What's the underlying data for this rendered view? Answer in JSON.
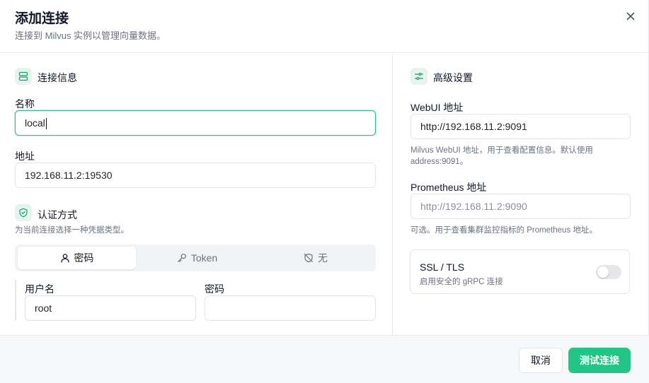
{
  "dialog": {
    "title": "添加连接",
    "subtitle": "连接到 Milvus 实例以管理向量数据。"
  },
  "connection_info": {
    "section_title": "连接信息",
    "name_label": "名称",
    "name_value": "local",
    "address_label": "地址",
    "address_value": "192.168.11.2:19530"
  },
  "auth": {
    "section_title": "认证方式",
    "description": "为当前连接选择一种凭据类型。",
    "tabs": [
      {
        "label": "密码",
        "icon": "user-icon",
        "active": true
      },
      {
        "label": "Token",
        "icon": "key-icon",
        "active": false
      },
      {
        "label": "无",
        "icon": "shield-off-icon",
        "active": false
      }
    ],
    "username_label": "用户名",
    "username_value": "root",
    "password_label": "密码",
    "password_value": ""
  },
  "advanced": {
    "section_title": "高级设置",
    "webui_label": "WebUI 地址",
    "webui_value": "http://192.168.11.2:9091",
    "webui_hint": "Milvus WebUI 地址，用于查看配置信息。默认使用 address:9091。",
    "prometheus_label": "Prometheus 地址",
    "prometheus_placeholder": "http://192.168.11.2:9090",
    "prometheus_hint": "可选。用于查看集群监控指标的 Prometheus 地址。",
    "ssl_title": "SSL / TLS",
    "ssl_description": "启用安全的 gRPC 连接",
    "ssl_enabled": false
  },
  "footer": {
    "cancel_label": "取消",
    "test_label": "测试连接"
  },
  "colors": {
    "accent": "#22c585",
    "focus_border": "#2cc28e",
    "icon_bg": "#e6f4ee"
  }
}
